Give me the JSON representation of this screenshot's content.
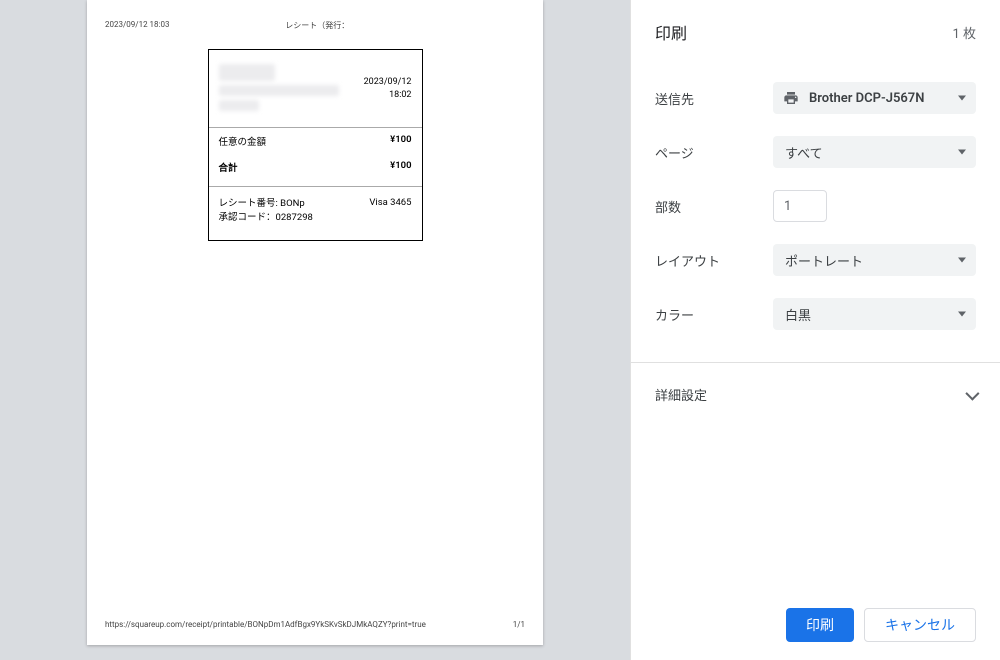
{
  "preview": {
    "sheet": {
      "header_left": "2023/09/12 18:03",
      "header_center": "レシート（発行：",
      "footer_url": "https://squareup.com/receipt/printable/BONpDm1AdfBgx9YkSKvSkDJMkAQZY?print=true",
      "footer_page": "1/1"
    },
    "receipt": {
      "date": "2023/09/12",
      "time": "18:02",
      "amount_label": "任意の金額",
      "amount_value": "¥100",
      "total_label": "合計",
      "total_value": "¥100",
      "receipt_no_label": "レシート番号: BONp",
      "card_info": "Visa 3465",
      "auth_label": "承認コード：0287298"
    }
  },
  "panel": {
    "title": "印刷",
    "sheet_count": "1 枚",
    "destination_label": "送信先",
    "destination_value": "Brother DCP-J567N",
    "pages_label": "ページ",
    "pages_value": "すべて",
    "copies_label": "部数",
    "copies_value": "1",
    "layout_label": "レイアウト",
    "layout_value": "ポートレート",
    "color_label": "カラー",
    "color_value": "白黒",
    "advanced_label": "詳細設定",
    "print_btn": "印刷",
    "cancel_btn": "キャンセル"
  }
}
